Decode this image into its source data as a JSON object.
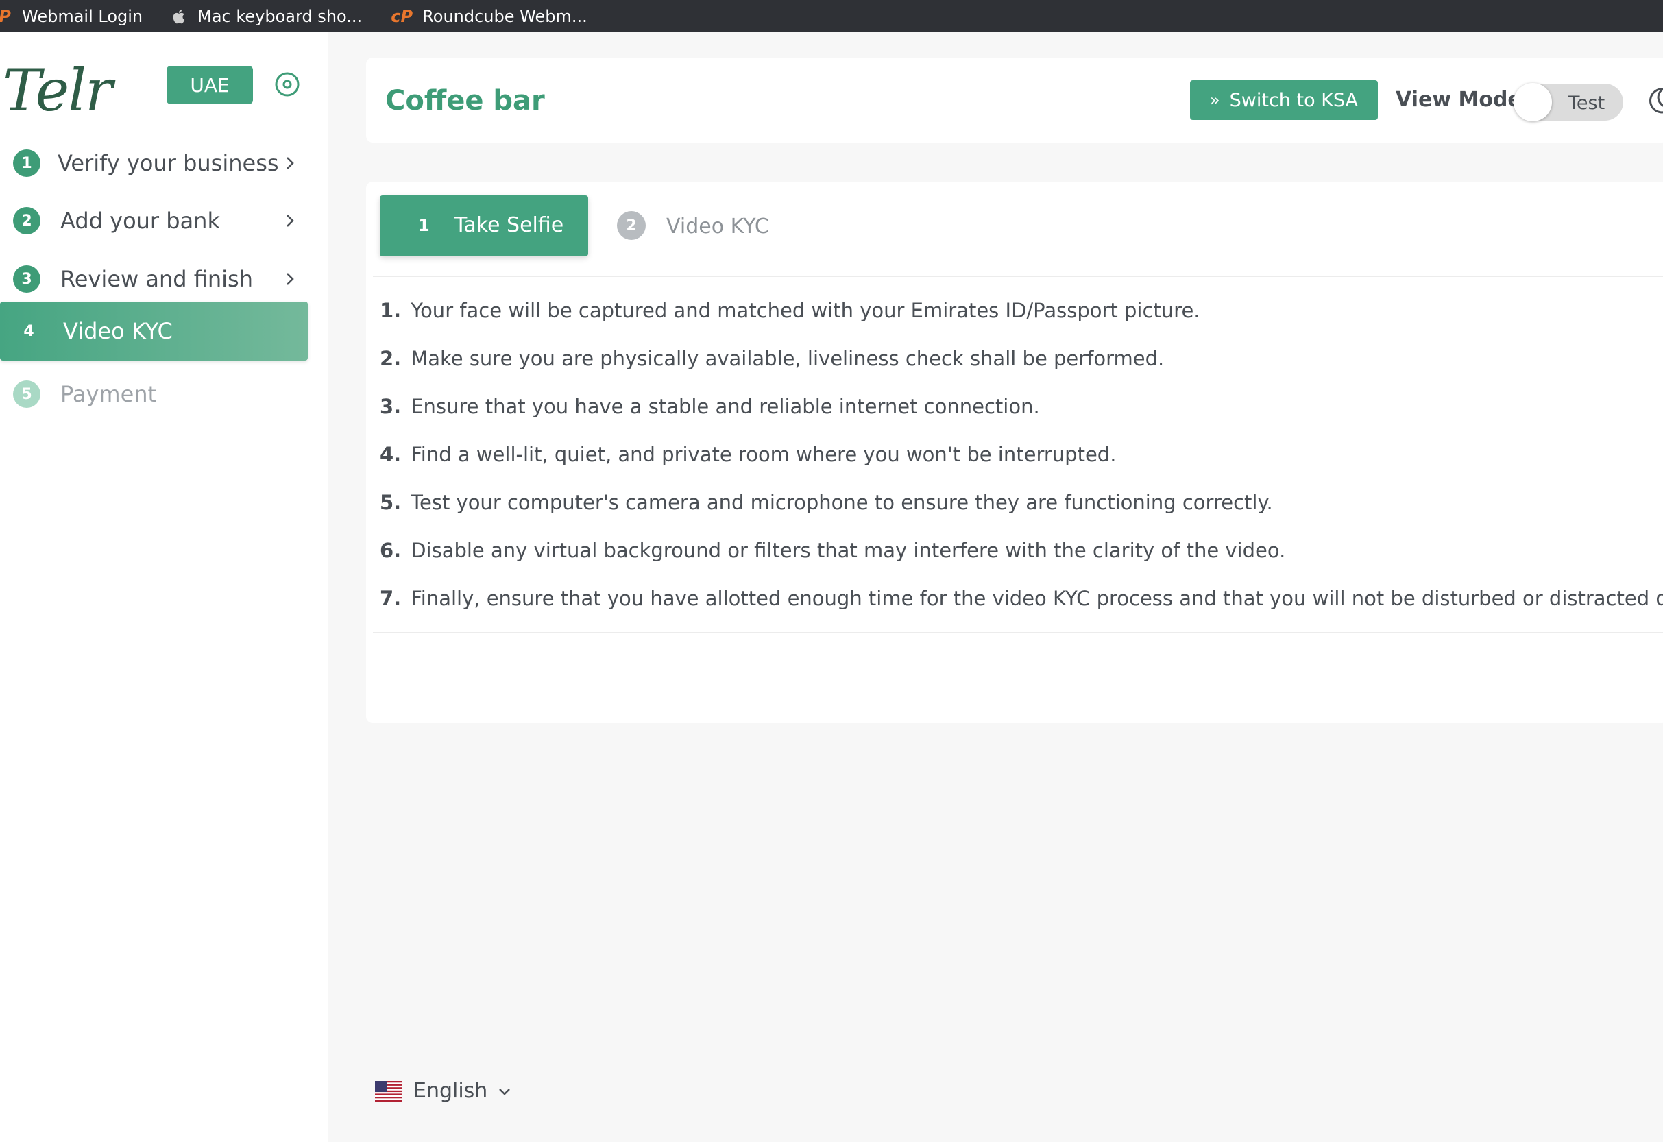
{
  "bookmarks": [
    {
      "label": "Webmail Login",
      "icon": "cpanel-icon"
    },
    {
      "label": "Mac keyboard sho...",
      "icon": "apple-icon"
    },
    {
      "label": "Roundcube Webm...",
      "icon": "cpanel-icon"
    }
  ],
  "sidebar": {
    "logo": "Telr",
    "country": "UAE",
    "items": [
      {
        "num": "1",
        "label": "Verify your business",
        "state": "done"
      },
      {
        "num": "2",
        "label": "Add your bank",
        "state": "done"
      },
      {
        "num": "3",
        "label": "Review and finish",
        "state": "done"
      },
      {
        "num": "4",
        "label": "Video KYC",
        "state": "active"
      },
      {
        "num": "5",
        "label": "Payment",
        "state": "disabled"
      }
    ]
  },
  "header": {
    "title": "Coffee bar",
    "switch_label": "Switch to KSA",
    "view_mode_label": "View Mode",
    "toggle_label": "Test"
  },
  "steps": [
    {
      "num": "1",
      "label": "Take Selfie"
    },
    {
      "num": "2",
      "label": "Video KYC"
    }
  ],
  "instructions": [
    {
      "num": "1.",
      "text": "Your face will be captured and matched with your Emirates ID/Passport picture."
    },
    {
      "num": "2.",
      "text": "Make sure you are physically available, liveliness check shall be performed."
    },
    {
      "num": "3.",
      "text": "Ensure that you have a stable and reliable internet connection."
    },
    {
      "num": "4.",
      "text": "Find a well-lit, quiet, and private room where you won't be interrupted."
    },
    {
      "num": "5.",
      "text": "Test your computer's camera and microphone to ensure they are functioning correctly."
    },
    {
      "num": "6.",
      "text": "Disable any virtual background or filters that may interfere with the clarity of the video."
    },
    {
      "num": "7.",
      "text": "Finally, ensure that you have allotted enough time for the video KYC process and that you will not be disturbed or distracted duri"
    }
  ],
  "language": {
    "label": "English",
    "flag": "us-flag-icon"
  },
  "colors": {
    "brand_green": "#44a380",
    "title_green": "#3e9c77",
    "bookmarks_bg": "#2f3136"
  }
}
